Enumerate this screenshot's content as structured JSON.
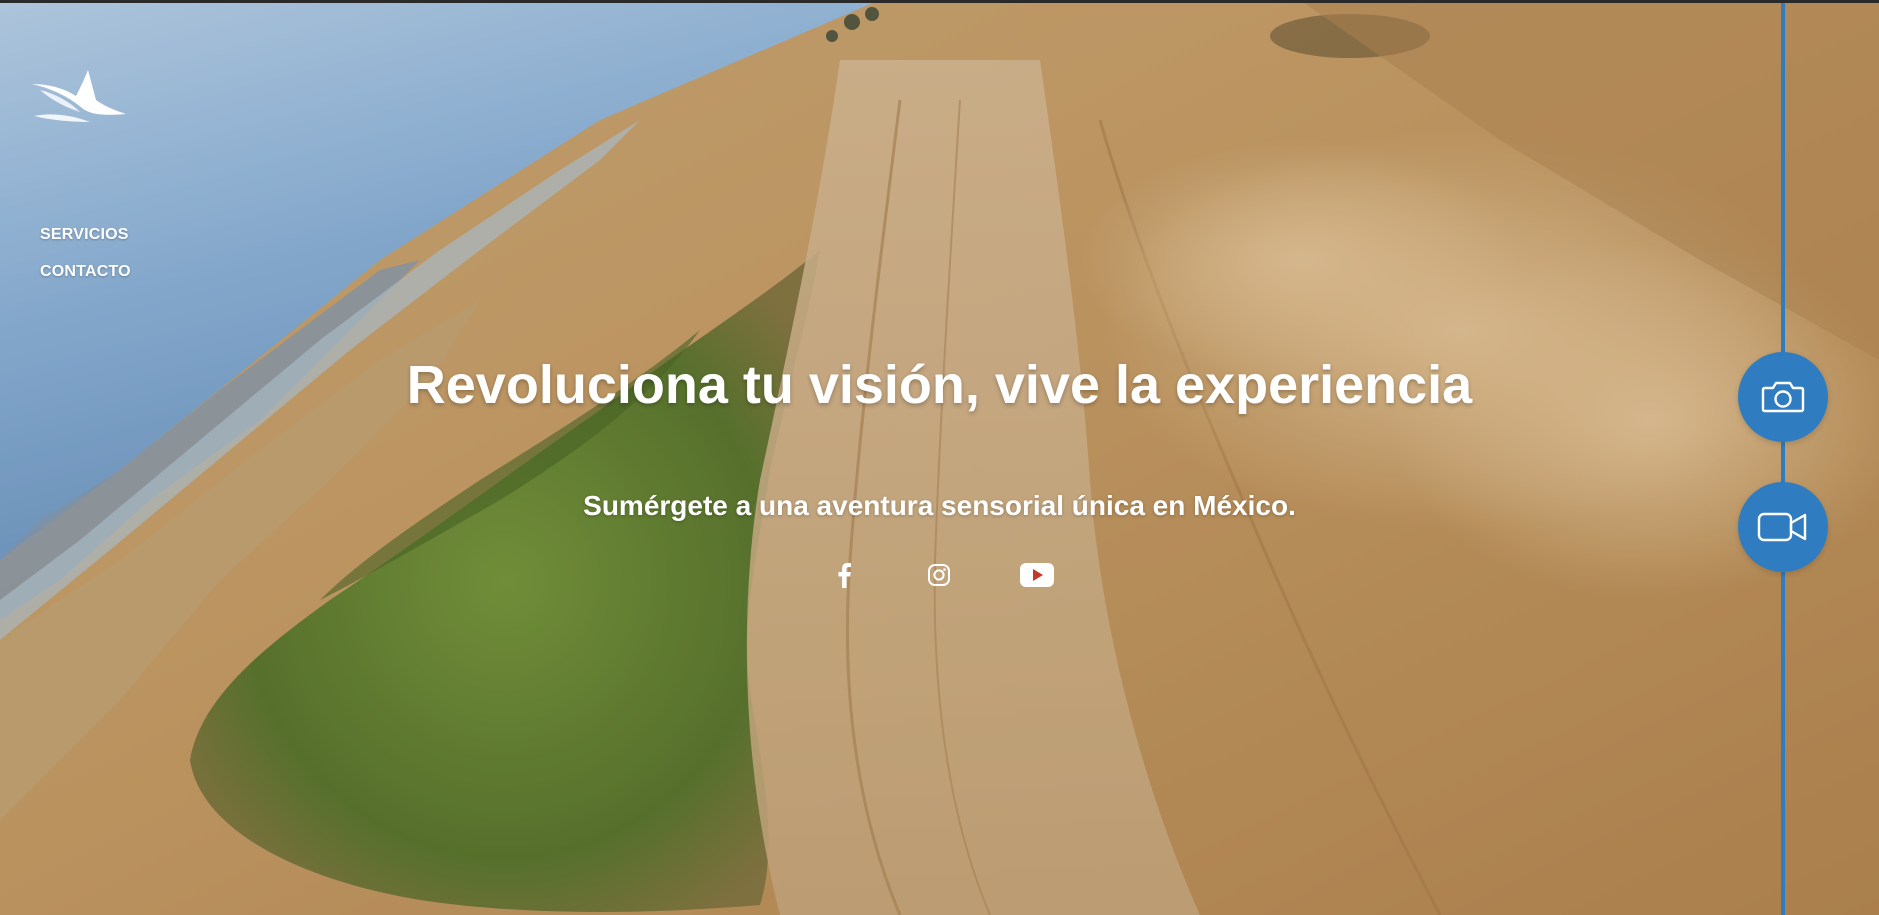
{
  "nav": {
    "services_label": "SERVICIOS",
    "contact_label": "CONTACTO"
  },
  "hero": {
    "headline": "Revoluciona tu visión, vive la experiencia",
    "subheadline": "Sumérgete a una aventura sensorial única en México."
  },
  "social": {
    "icons": [
      "facebook-icon",
      "instagram-icon",
      "youtube-icon"
    ]
  },
  "side_actions": {
    "icons": [
      "camera-icon",
      "video-camera-icon"
    ]
  },
  "colors": {
    "accent": "#2f7dc0",
    "text": "#ffffff",
    "sand": "#c9a06a",
    "vegetation": "#6f8a3a",
    "sky": "#9fc3e6"
  }
}
